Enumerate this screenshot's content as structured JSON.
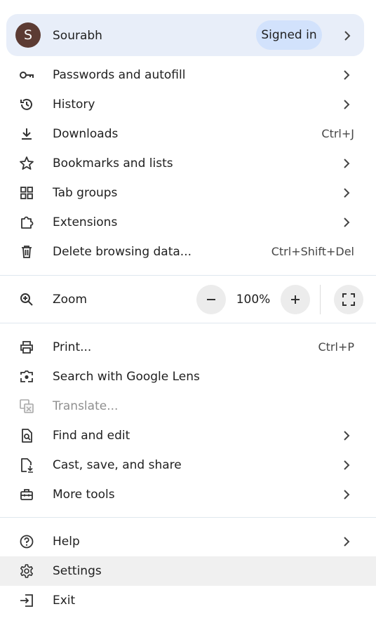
{
  "profile": {
    "initial": "S",
    "name": "Sourabh",
    "status": "Signed in"
  },
  "items_top": [
    {
      "label": "Passwords and autofill",
      "icon": "key-icon",
      "submenu": true
    },
    {
      "label": "History",
      "icon": "history-icon",
      "submenu": true
    },
    {
      "label": "Downloads",
      "icon": "download-icon",
      "shortcut": "Ctrl+J"
    },
    {
      "label": "Bookmarks and lists",
      "icon": "star-icon",
      "submenu": true
    },
    {
      "label": "Tab groups",
      "icon": "tab-groups-icon",
      "submenu": true
    },
    {
      "label": "Extensions",
      "icon": "extension-puzzle-icon",
      "submenu": true
    },
    {
      "label": "Delete browsing data...",
      "icon": "trash-icon",
      "shortcut": "Ctrl+Shift+Del"
    }
  ],
  "zoom": {
    "label": "Zoom",
    "value": "100%",
    "icon": "zoom-icon"
  },
  "items_mid": [
    {
      "label": "Print...",
      "icon": "printer-icon",
      "shortcut": "Ctrl+P"
    },
    {
      "label": "Search with Google Lens",
      "icon": "lens-icon"
    },
    {
      "label": "Translate...",
      "icon": "translate-icon",
      "disabled": true
    },
    {
      "label": "Find and edit",
      "icon": "find-page-icon",
      "submenu": true
    },
    {
      "label": "Cast, save, and share",
      "icon": "cast-save-icon",
      "submenu": true
    },
    {
      "label": "More tools",
      "icon": "toolbox-icon",
      "submenu": true
    }
  ],
  "items_bottom": [
    {
      "label": "Help",
      "icon": "help-icon",
      "submenu": true
    },
    {
      "label": "Settings",
      "icon": "gear-icon",
      "highlighted": true
    },
    {
      "label": "Exit",
      "icon": "exit-icon"
    }
  ],
  "colors": {
    "profile_bg": "#e8eef9",
    "pill_bg": "#d2e2fc",
    "avatar_bg": "#5c3b33",
    "hover_bg": "#f0f0f0"
  }
}
